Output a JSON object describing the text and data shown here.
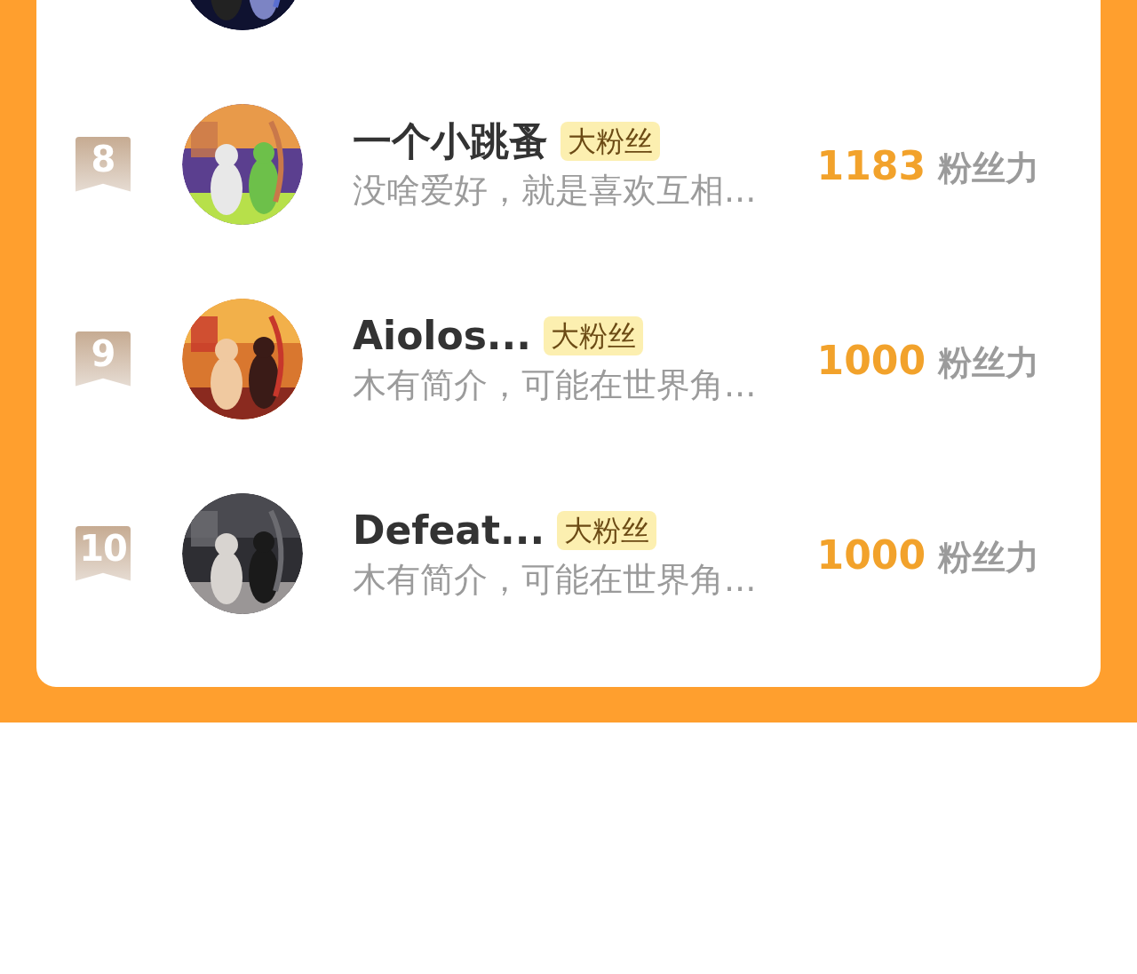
{
  "rows": [
    {
      "rank": "8",
      "name": "一个小跳蚤",
      "tag": "大粉丝",
      "bio": "没啥爱好，就是喜欢互相...",
      "score": "1183",
      "score_unit": "粉丝力"
    },
    {
      "rank": "9",
      "name": "Aiolos...",
      "tag": "大粉丝",
      "bio": "木有简介，可能在世界角...",
      "score": "1000",
      "score_unit": "粉丝力"
    },
    {
      "rank": "10",
      "name": "Defeat...",
      "tag": "大粉丝",
      "bio": "木有简介，可能在世界角...",
      "score": "1000",
      "score_unit": "粉丝力"
    }
  ]
}
